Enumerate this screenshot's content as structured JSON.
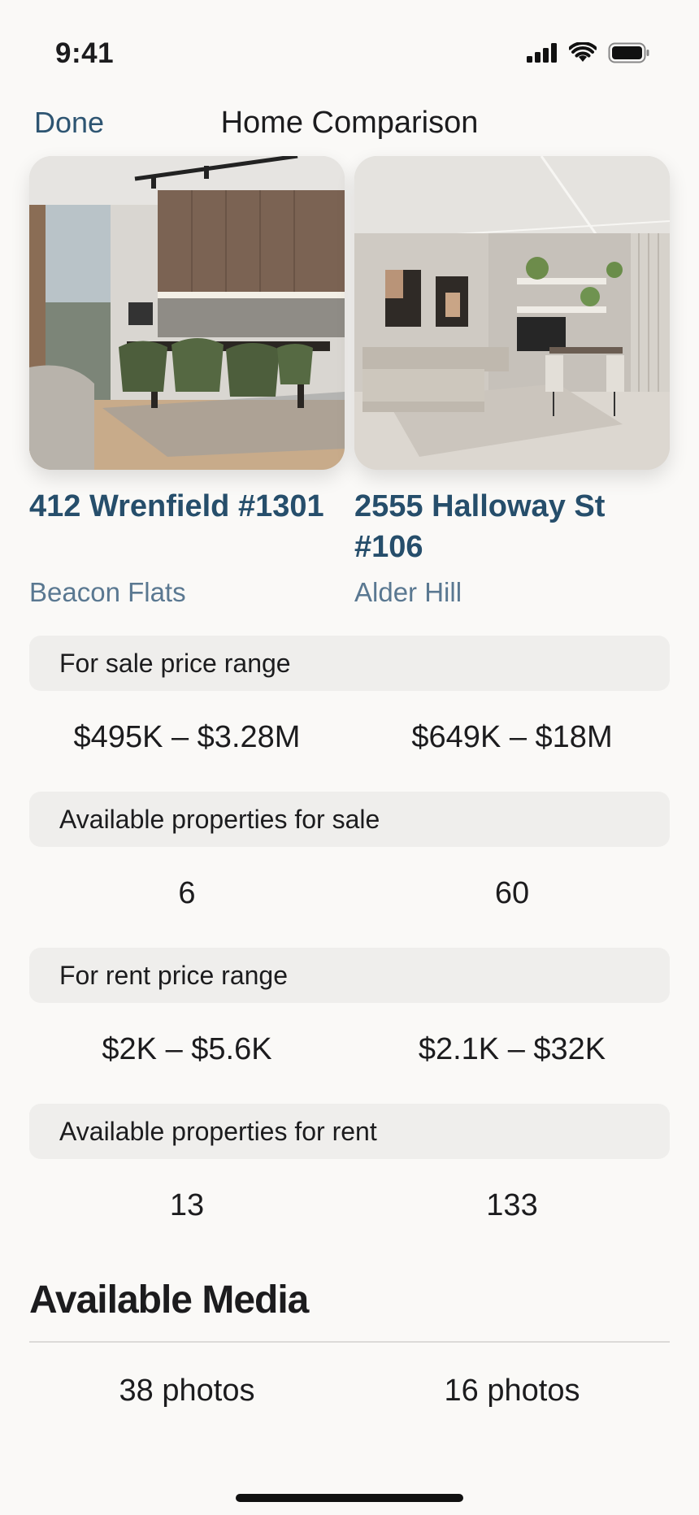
{
  "status_bar": {
    "time": "9:41",
    "icons": [
      "signal-icon",
      "wifi-icon",
      "battery-icon"
    ]
  },
  "nav": {
    "done_label": "Done",
    "title": "Home Comparison"
  },
  "homes": [
    {
      "address": "412 Wrenfield #1301",
      "neighborhood": "Beacon Flats",
      "photo": "kitchen-dining-photo"
    },
    {
      "address": "2555 Halloway St #106",
      "neighborhood": "Alder Hill",
      "photo": "living-room-photo"
    }
  ],
  "rows": [
    {
      "label": "For sale price range",
      "values": [
        "$495K – $3.28M",
        "$649K – $18M"
      ]
    },
    {
      "label": "Available properties for sale",
      "values": [
        "6",
        "60"
      ]
    },
    {
      "label": "For rent price range",
      "values": [
        "$2K – $5.6K",
        "$2.1K – $32K"
      ]
    },
    {
      "label": "Available properties for rent",
      "values": [
        "13",
        "133"
      ]
    }
  ],
  "media": {
    "title": "Available Media",
    "values": [
      "38 photos",
      "16 photos"
    ]
  },
  "colors": {
    "accent": "#2e5572",
    "address": "#264e6b",
    "neighborhood": "#5a7891",
    "row_bg": "#efeeec",
    "background": "#faf9f7"
  }
}
